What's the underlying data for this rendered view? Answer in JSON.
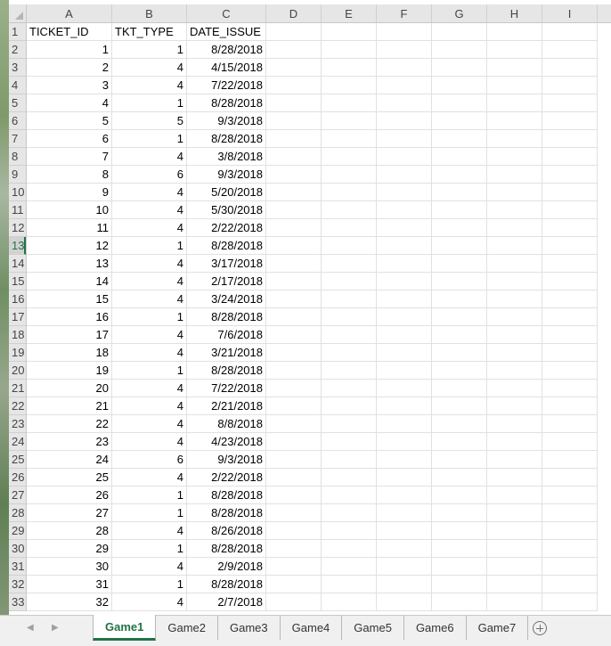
{
  "columns": [
    "A",
    "B",
    "C",
    "D",
    "E",
    "F",
    "G",
    "H",
    "I"
  ],
  "header_row": {
    "row_number": "1",
    "ticket_id": "TICKET_ID",
    "tkt_type": "TKT_TYPE",
    "date_issue": "DATE_ISSUE"
  },
  "rows": [
    {
      "row_number": "2",
      "ticket_id": "1",
      "tkt_type": "1",
      "date_issue": "8/28/2018"
    },
    {
      "row_number": "3",
      "ticket_id": "2",
      "tkt_type": "4",
      "date_issue": "4/15/2018"
    },
    {
      "row_number": "4",
      "ticket_id": "3",
      "tkt_type": "4",
      "date_issue": "7/22/2018"
    },
    {
      "row_number": "5",
      "ticket_id": "4",
      "tkt_type": "1",
      "date_issue": "8/28/2018"
    },
    {
      "row_number": "6",
      "ticket_id": "5",
      "tkt_type": "5",
      "date_issue": "9/3/2018"
    },
    {
      "row_number": "7",
      "ticket_id": "6",
      "tkt_type": "1",
      "date_issue": "8/28/2018"
    },
    {
      "row_number": "8",
      "ticket_id": "7",
      "tkt_type": "4",
      "date_issue": "3/8/2018"
    },
    {
      "row_number": "9",
      "ticket_id": "8",
      "tkt_type": "6",
      "date_issue": "9/3/2018"
    },
    {
      "row_number": "10",
      "ticket_id": "9",
      "tkt_type": "4",
      "date_issue": "5/20/2018"
    },
    {
      "row_number": "11",
      "ticket_id": "10",
      "tkt_type": "4",
      "date_issue": "5/30/2018"
    },
    {
      "row_number": "12",
      "ticket_id": "11",
      "tkt_type": "4",
      "date_issue": "2/22/2018"
    },
    {
      "row_number": "13",
      "ticket_id": "12",
      "tkt_type": "1",
      "date_issue": "8/28/2018"
    },
    {
      "row_number": "14",
      "ticket_id": "13",
      "tkt_type": "4",
      "date_issue": "3/17/2018"
    },
    {
      "row_number": "15",
      "ticket_id": "14",
      "tkt_type": "4",
      "date_issue": "2/17/2018"
    },
    {
      "row_number": "16",
      "ticket_id": "15",
      "tkt_type": "4",
      "date_issue": "3/24/2018"
    },
    {
      "row_number": "17",
      "ticket_id": "16",
      "tkt_type": "1",
      "date_issue": "8/28/2018"
    },
    {
      "row_number": "18",
      "ticket_id": "17",
      "tkt_type": "4",
      "date_issue": "7/6/2018"
    },
    {
      "row_number": "19",
      "ticket_id": "18",
      "tkt_type": "4",
      "date_issue": "3/21/2018"
    },
    {
      "row_number": "20",
      "ticket_id": "19",
      "tkt_type": "1",
      "date_issue": "8/28/2018"
    },
    {
      "row_number": "21",
      "ticket_id": "20",
      "tkt_type": "4",
      "date_issue": "7/22/2018"
    },
    {
      "row_number": "22",
      "ticket_id": "21",
      "tkt_type": "4",
      "date_issue": "2/21/2018"
    },
    {
      "row_number": "23",
      "ticket_id": "22",
      "tkt_type": "4",
      "date_issue": "8/8/2018"
    },
    {
      "row_number": "24",
      "ticket_id": "23",
      "tkt_type": "4",
      "date_issue": "4/23/2018"
    },
    {
      "row_number": "25",
      "ticket_id": "24",
      "tkt_type": "6",
      "date_issue": "9/3/2018"
    },
    {
      "row_number": "26",
      "ticket_id": "25",
      "tkt_type": "4",
      "date_issue": "2/22/2018"
    },
    {
      "row_number": "27",
      "ticket_id": "26",
      "tkt_type": "1",
      "date_issue": "8/28/2018"
    },
    {
      "row_number": "28",
      "ticket_id": "27",
      "tkt_type": "1",
      "date_issue": "8/28/2018"
    },
    {
      "row_number": "29",
      "ticket_id": "28",
      "tkt_type": "4",
      "date_issue": "8/26/2018"
    },
    {
      "row_number": "30",
      "ticket_id": "29",
      "tkt_type": "1",
      "date_issue": "8/28/2018"
    },
    {
      "row_number": "31",
      "ticket_id": "30",
      "tkt_type": "4",
      "date_issue": "2/9/2018"
    },
    {
      "row_number": "32",
      "ticket_id": "31",
      "tkt_type": "1",
      "date_issue": "8/28/2018"
    },
    {
      "row_number": "33",
      "ticket_id": "32",
      "tkt_type": "4",
      "date_issue": "2/7/2018"
    }
  ],
  "active_row": "13",
  "sheet_nav": {
    "prev_icon": "triangle-left-icon",
    "next_icon": "triangle-right-icon"
  },
  "sheet_tabs": [
    {
      "label": "Game1",
      "active": true
    },
    {
      "label": "Game2",
      "active": false
    },
    {
      "label": "Game3",
      "active": false
    },
    {
      "label": "Game4",
      "active": false
    },
    {
      "label": "Game5",
      "active": false
    },
    {
      "label": "Game6",
      "active": false
    },
    {
      "label": "Game7",
      "active": false
    }
  ],
  "add_sheet_icon": "plus-circle-icon",
  "colors": {
    "accent": "#217346",
    "header_bg": "#e6e6e6",
    "gridline": "#e1e1e1"
  }
}
